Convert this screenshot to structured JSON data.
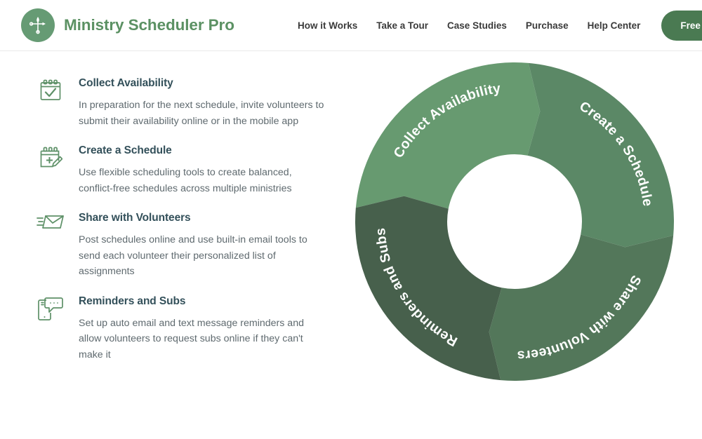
{
  "header": {
    "brand_title": "Ministry Scheduler Pro",
    "brand_icon": "cross-compass-icon",
    "nav": [
      {
        "label": "How it Works",
        "name": "nav-how-it-works"
      },
      {
        "label": "Take a Tour",
        "name": "nav-take-a-tour"
      },
      {
        "label": "Case Studies",
        "name": "nav-case-studies"
      },
      {
        "label": "Purchase",
        "name": "nav-purchase"
      },
      {
        "label": "Help Center",
        "name": "nav-help-center"
      }
    ],
    "cta_label": "Free Trial"
  },
  "features": [
    {
      "title": "Collect Availability",
      "desc": "In preparation for the next schedule, invite volunteers to submit their availability online or in the mobile app",
      "icon": "calendar-check-icon"
    },
    {
      "title": "Create a Schedule",
      "desc": "Use flexible scheduling tools to create balanced, conflict-free schedules across multiple ministries",
      "icon": "calendar-edit-icon"
    },
    {
      "title": "Share with Volunteers",
      "desc": "Post schedules online and use built-in email tools to send each volunteer their personalized list of assignments",
      "icon": "envelope-send-icon"
    },
    {
      "title": "Reminders and Subs",
      "desc": "Set up auto email and text message reminders and allow volunteers to request subs online if they can't make it",
      "icon": "phone-chat-icon"
    }
  ],
  "chart_data": {
    "type": "pie",
    "title": "",
    "variant": "donut-cycle",
    "legend": "none",
    "segments": [
      {
        "label": "Collect Availability",
        "value": 25,
        "color": "#679a70",
        "start_angle": 270,
        "end_angle": 360
      },
      {
        "label": "Create a Schedule",
        "value": 25,
        "color": "#5b8866",
        "start_angle": 0,
        "end_angle": 90
      },
      {
        "label": "Share with Volunteers",
        "value": 25,
        "color": "#53775a",
        "start_angle": 90,
        "end_angle": 180
      },
      {
        "label": "Reminders and Subs",
        "value": 25,
        "color": "#47604c",
        "start_angle": 180,
        "end_angle": 270
      }
    ],
    "inner_radius_ratio": 0.42,
    "outer_radius_ratio": 1.0
  },
  "colors": {
    "brand_green": "#5b9163",
    "cta_green": "#4a7a52",
    "logo_green": "#669b74",
    "heading_slate": "#33505a",
    "body_gray": "#5f6a6f",
    "icon_green": "#5e9168",
    "border_gray": "#e9e9e9"
  }
}
